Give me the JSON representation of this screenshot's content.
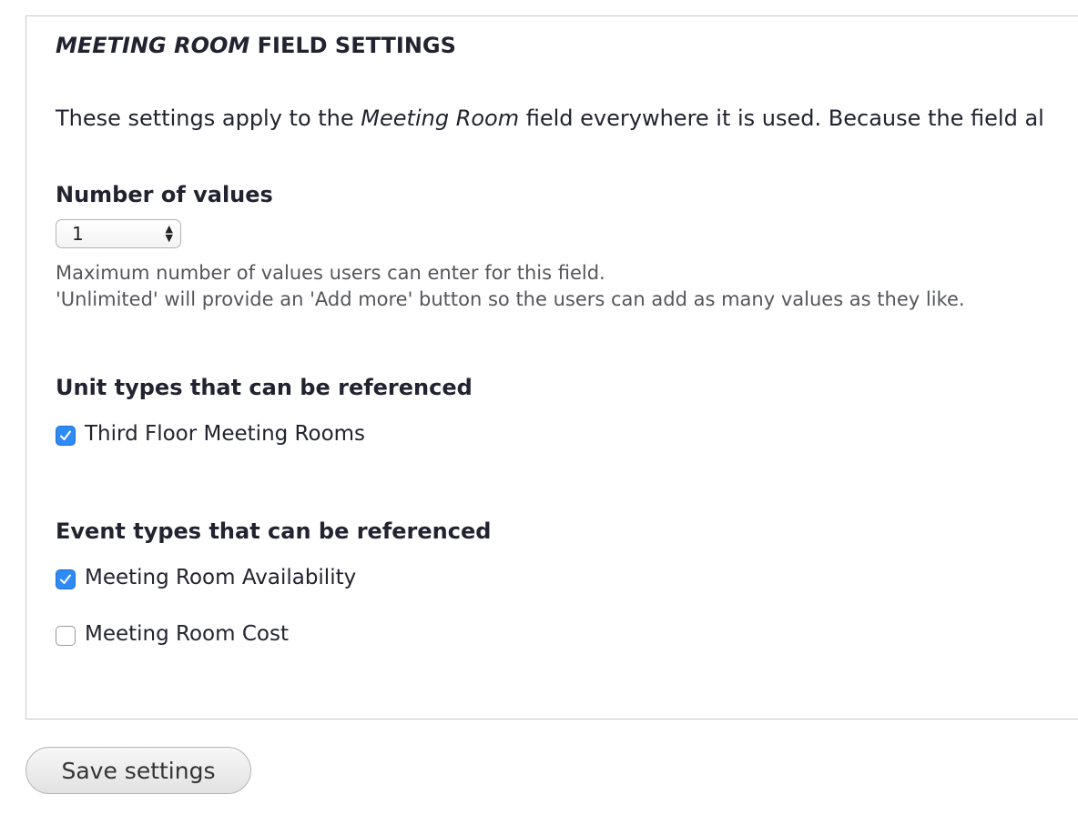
{
  "fieldset": {
    "legend_italic": "MEETING ROOM",
    "legend_rest": " FIELD SETTINGS",
    "intro_before": "These settings apply to the ",
    "intro_italic": "Meeting Room",
    "intro_after": " field everywhere it is used. Because the field al"
  },
  "number_of_values": {
    "label": "Number of values",
    "selected_value": "1",
    "description_line1": "Maximum number of values users can enter for this field.",
    "description_line2": "'Unlimited' will provide an 'Add more' button so the users can add as many values as they like."
  },
  "unit_types": {
    "label": "Unit types that can be referenced",
    "options": [
      {
        "label": "Third Floor Meeting Rooms",
        "checked": true
      }
    ]
  },
  "event_types": {
    "label": "Event types that can be referenced",
    "options": [
      {
        "label": "Meeting Room Availability",
        "checked": true
      },
      {
        "label": "Meeting Room Cost",
        "checked": false
      }
    ]
  },
  "actions": {
    "save_label": "Save settings"
  },
  "icons": {
    "checkmark": "checkmark-icon",
    "select_arrows": "updown-arrows-icon"
  },
  "colors": {
    "checkbox_checked": "#2e8af5",
    "text": "#222330",
    "description": "#55565b"
  }
}
